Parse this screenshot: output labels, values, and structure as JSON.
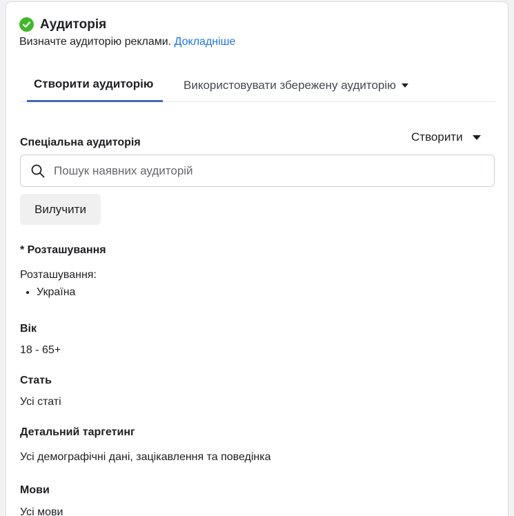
{
  "header": {
    "title": "Аудиторія",
    "subtitle": "Визначте аудиторію реклами.",
    "learn_more": "Докладніше"
  },
  "tabs": [
    {
      "label": "Створити аудиторію",
      "active": true
    },
    {
      "label": "Використовувати збережену аудиторію",
      "active": false
    }
  ],
  "custom_audience": {
    "label": "Спеціальна аудиторія",
    "create_label": "Створити",
    "search_placeholder": "Пошук наявних аудиторій",
    "exclude_label": "Вилучити"
  },
  "location": {
    "label": "* Розташування",
    "sub_label": "Розташування:",
    "items": [
      "Україна"
    ]
  },
  "age": {
    "label": "Вік",
    "value": "18 - 65+"
  },
  "gender": {
    "label": "Стать",
    "value": "Усі статі"
  },
  "detailed_targeting": {
    "label": "Детальний таргетинг",
    "value": "Усі демографічні дані, зацікавлення та поведінка"
  },
  "languages": {
    "label": "Мови",
    "value": "Усі мови"
  },
  "colors": {
    "accent": "#4267b2",
    "link": "#1b74e4",
    "success": "#42b72a"
  }
}
